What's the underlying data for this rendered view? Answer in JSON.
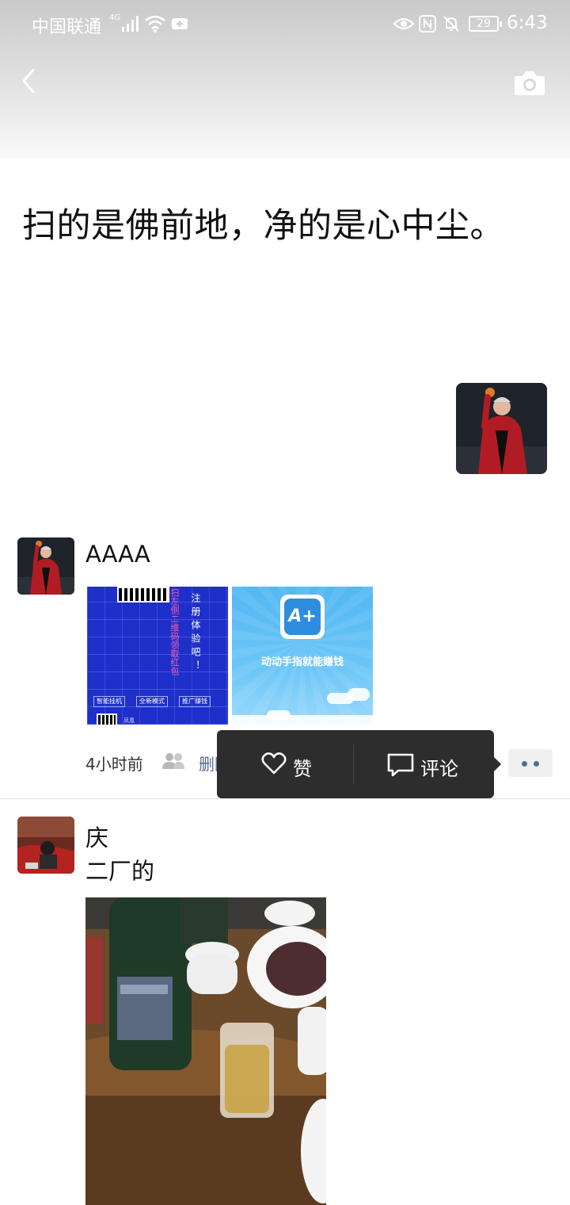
{
  "status_bar": {
    "carrier": "中国联通",
    "network": "4G",
    "battery": "29",
    "time": "6:43"
  },
  "header": {
    "back_icon": "chevron-left-icon",
    "camera_icon": "camera-icon",
    "signature": "扫的是佛前地，净的是心中尘。"
  },
  "posts": [
    {
      "author": "AAAA",
      "images": [
        {
          "name": "qr-promo-image",
          "lines": [
            "扫左侧二维码领取红包",
            "注册体验吧！"
          ],
          "buttons": [
            "智能挂机",
            "全新模式",
            "推广赚钱"
          ],
          "footer": "凤凰"
        },
        {
          "name": "app-promo-image",
          "logo": "A+",
          "slogan": "动动手指就能赚钱"
        }
      ],
      "time": "4小时前",
      "delete_label": "删除"
    },
    {
      "author": "庆",
      "text": "二厂的"
    }
  ],
  "action_menu": {
    "like_label": "赞",
    "comment_label": "评论"
  },
  "colors": {
    "link": "#576b95",
    "menu_bg": "#2d2d2d",
    "text": "#111111"
  }
}
